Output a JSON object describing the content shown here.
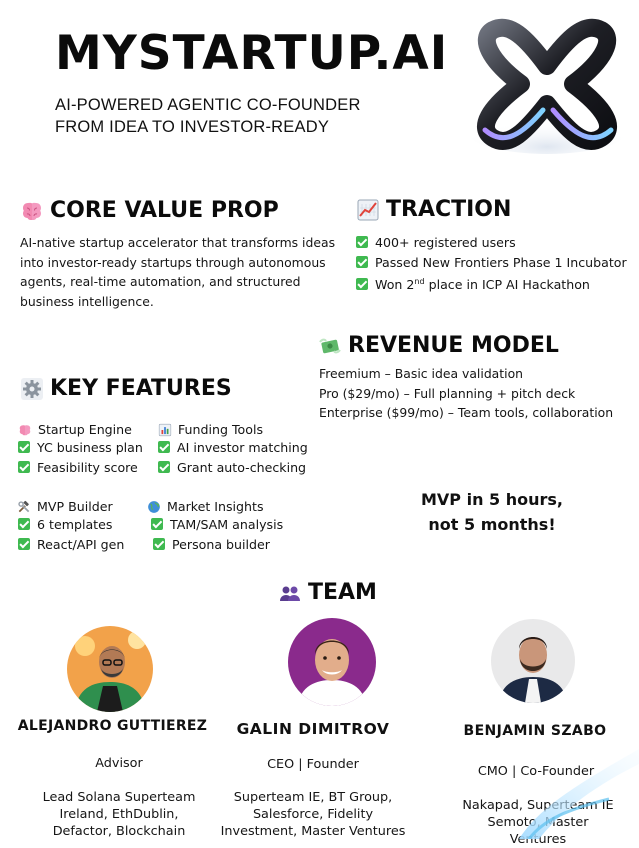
{
  "header": {
    "title": "MYSTARTUP.AI",
    "tagline_line1": "AI-POWERED AGENTIC CO-FOUNDER",
    "tagline_line2": "FROM IDEA TO INVESTOR-READY",
    "logo_icon": "stylized-x-logo"
  },
  "core_value": {
    "heading": "CORE VALUE PROP",
    "icon": "brain-icon",
    "text_lines": [
      "AI-native startup accelerator that transforms ideas",
      "into investor-ready startups through autonomous",
      "agents, real-time automation, and structured",
      "business intelligence."
    ]
  },
  "traction": {
    "heading": "TRACTION",
    "icon": "chart-increasing-icon",
    "items": [
      "400+ registered users",
      "Passed New Frontiers Phase 1 Incubator",
      "Won 2",
      "nd",
      " place in ICP AI Hackathon"
    ]
  },
  "revenue": {
    "heading": "REVENUE MODEL",
    "icon": "money-with-wings-icon",
    "lines": [
      "Freemium – Basic idea validation",
      "Pro ($29/mo) – Full planning + pitch deck",
      "Enterprise ($99/mo) – Team tools, collaboration"
    ]
  },
  "features": {
    "heading": "KEY FEATURES",
    "icon": "gear-icon",
    "groups": [
      {
        "title": "Startup Engine",
        "icon": "brain-icon",
        "items": [
          "YC business plan",
          "Feasibility score"
        ]
      },
      {
        "title": "Funding Tools",
        "icon": "bar-chart-icon",
        "items": [
          "AI investor matching",
          "Grant auto-checking"
        ]
      },
      {
        "title": "MVP Builder",
        "icon": "hammer-wrench-icon",
        "items": [
          "6 templates",
          "React/API gen"
        ]
      },
      {
        "title": "Market Insights",
        "icon": "globe-icon",
        "items": [
          "TAM/SAM analysis",
          "Persona builder"
        ]
      }
    ]
  },
  "mvp_callout": {
    "line1": "MVP in 5 hours,",
    "line2": "not 5 months!"
  },
  "team": {
    "heading": "TEAM",
    "icon": "people-icon",
    "members": [
      {
        "name": "ALEJANDRO GUTTIEREZ",
        "role": "Advisor",
        "bio_lines": [
          "Lead Solana Superteam",
          "Ireland, EthDublin,",
          "Defactor,  Blockchain"
        ]
      },
      {
        "name": "GALIN DIMITROV",
        "role": "CEO | Founder",
        "bio_lines": [
          "Superteam IE, BT Group,",
          "Salesforce, Fidelity",
          "Investment, Master Ventures"
        ]
      },
      {
        "name": "BENJAMIN SZABO",
        "role": "CMO | Co-Founder",
        "bio_lines": [
          "Nakapad, Superteam IE",
          "Semoto, Master",
          "Ventures"
        ]
      }
    ]
  },
  "colors": {
    "check_green": "#3fb950",
    "text": "#111111",
    "avatar1_bg": "#f2a24a",
    "avatar2_bg": "#8a2a8c",
    "avatar3_bg": "#e9e9ea"
  }
}
